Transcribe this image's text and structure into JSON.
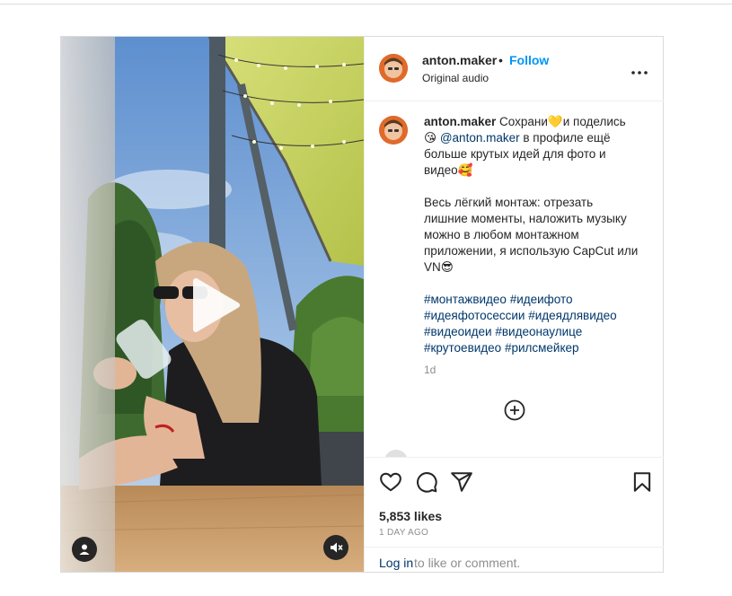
{
  "post": {
    "username": "anton.maker",
    "follow_label": "Follow",
    "separator": "•",
    "audio_label": "Original audio",
    "caption": {
      "username": "anton.maker",
      "line1_text": "Сохрани",
      "emoji_heart": "💛",
      "line1_text2": "и поделись",
      "emoji_kiss": "😘",
      "mention": "@anton.maker",
      "line1_text3": "в профиле ещё больше крутых идей для фото и видео",
      "emoji_love": "🥰",
      "paragraph2": "Весь лёгкий монтаж: отрезать лишние моменты, наложить музыку можно в любом монтажном приложении, я использую CapCut или VN",
      "emoji_cool": "😎",
      "hashtags": [
        "#монтажвидео",
        "#идеифото",
        "#идеяфотосессии",
        "#идеядлявидео",
        "#видеоидеи",
        "#видеонаулице",
        "#крутоевидео",
        "#рилсмейкер"
      ]
    },
    "caption_time": "1d",
    "likes": "5,853 likes",
    "time_ago": "1 DAY AGO",
    "login_link": "Log in",
    "login_rest": "to like or comment."
  },
  "colors": {
    "follow_blue": "#0095f6",
    "link_dark_blue": "#00376b",
    "border": "#dbdbdb",
    "muted": "#8e8e8e"
  },
  "icons": [
    "play-icon",
    "user-tag-icon",
    "mute-icon",
    "more-icon",
    "add-comment-icon",
    "heart-icon",
    "comment-icon",
    "share-icon",
    "bookmark-icon"
  ]
}
